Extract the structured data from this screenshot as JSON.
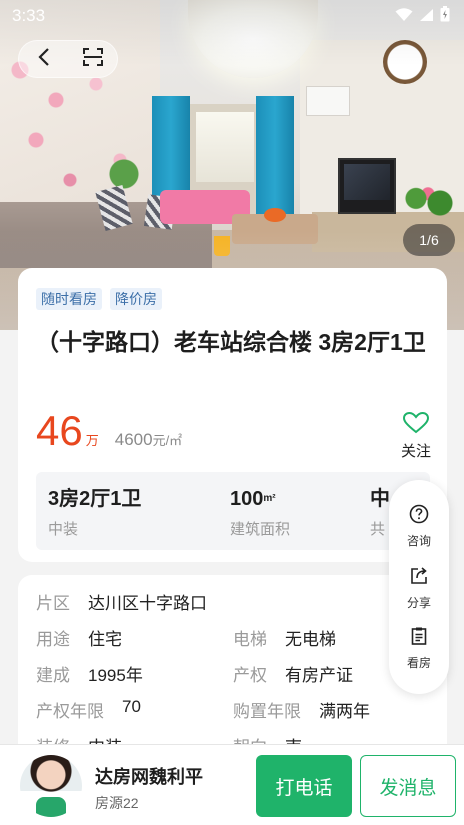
{
  "status_bar": {
    "time": "3:33"
  },
  "gallery": {
    "counter": "1/6"
  },
  "tags": [
    "随时看房",
    "降价房"
  ],
  "title": "（十字路口）老车站综合楼 3房2厅1卫",
  "price": {
    "total": "46",
    "total_unit": "万",
    "unit_price": "4600",
    "unit_price_suffix": "元/㎡"
  },
  "follow": {
    "label": "关注"
  },
  "stats": [
    {
      "value": "3房2厅1卫",
      "label": "中装"
    },
    {
      "value": "100",
      "value_unit": "m²",
      "label": "建筑面积"
    },
    {
      "value": "中",
      "label": "共"
    }
  ],
  "details": {
    "district": {
      "label": "片区",
      "value": "达川区十字路口"
    },
    "usage": {
      "label": "用途",
      "value": "住宅"
    },
    "elevator": {
      "label": "电梯",
      "value": "无电梯"
    },
    "built": {
      "label": "建成",
      "value": "1995年"
    },
    "ownership": {
      "label": "产权",
      "value": "有房产证"
    },
    "ownership_years": {
      "label": "产权年限",
      "value": "70"
    },
    "purchase_years": {
      "label": "购置年限",
      "value": "满两年"
    },
    "decoration": {
      "label": "装修",
      "value": "中装"
    },
    "orientation": {
      "label": "朝向",
      "value": "南"
    }
  },
  "side_panel": {
    "consult": {
      "label": "咨询",
      "icon": "question-circle-icon"
    },
    "share": {
      "label": "分享",
      "icon": "share-icon"
    },
    "viewing": {
      "label": "看房",
      "icon": "clipboard-icon"
    }
  },
  "agent": {
    "name": "达房网魏利平",
    "sub": "房源22"
  },
  "actions": {
    "call": "打电话",
    "message": "发消息"
  },
  "colors": {
    "accent_green": "#1fb36a",
    "price_red": "#e8471e",
    "tag_blue": "#3c6fa8"
  }
}
